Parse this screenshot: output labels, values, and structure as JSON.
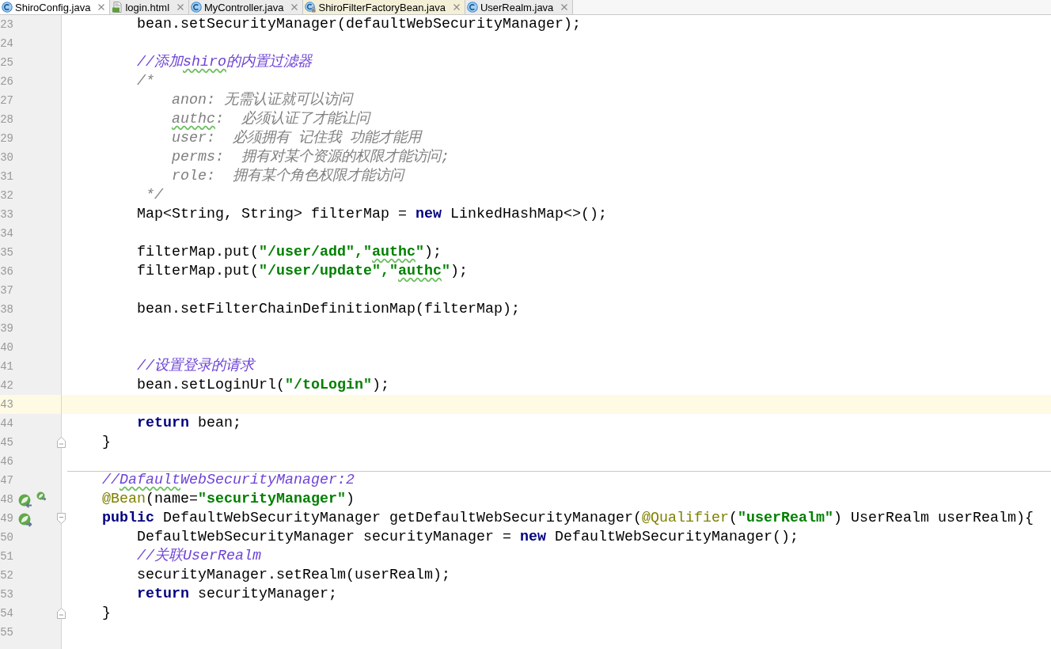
{
  "tabs": [
    {
      "label": "ShiroConfig.java",
      "kind": "class",
      "selected": true,
      "library": false
    },
    {
      "label": "login.html",
      "kind": "html",
      "selected": false,
      "library": false
    },
    {
      "label": "MyController.java",
      "kind": "class",
      "selected": false,
      "library": false
    },
    {
      "label": "ShiroFilterFactoryBean.java",
      "kind": "class-locked",
      "selected": false,
      "library": true
    },
    {
      "label": "UserRealm.java",
      "kind": "class",
      "selected": false,
      "library": false
    }
  ],
  "editor": {
    "lines": [
      {
        "number": "23",
        "segments": [
          {
            "text": "        bean.setSecurityManager(defaultWebSecurityManager);",
            "kind": "plain"
          }
        ]
      },
      {
        "number": "24"
      },
      {
        "number": "25",
        "segments": [
          {
            "text": "        //添加",
            "kind": "line_comment"
          },
          {
            "text": "shiro",
            "kind": "line_comment",
            "typo": true
          },
          {
            "text": "的内置过滤器",
            "kind": "line_comment"
          }
        ]
      },
      {
        "number": "26",
        "segments": [
          {
            "text": "        /*",
            "kind": "block_comment"
          }
        ]
      },
      {
        "number": "27",
        "segments": [
          {
            "text": "            anon: 无需认证就可以访问",
            "kind": "block_comment"
          }
        ]
      },
      {
        "number": "28",
        "segments": [
          {
            "text": "            authc",
            "kind": "block_comment",
            "typo": true
          },
          {
            "text": ":  必须认证了才能让问",
            "kind": "block_comment"
          }
        ]
      },
      {
        "number": "29",
        "segments": [
          {
            "text": "            user:  必须拥有 记住我 功能才能用",
            "kind": "block_comment"
          }
        ]
      },
      {
        "number": "30",
        "segments": [
          {
            "text": "            perms:  拥有对某个资源的权限才能访问;",
            "kind": "block_comment"
          }
        ]
      },
      {
        "number": "31",
        "segments": [
          {
            "text": "            role:  拥有某个角色权限才能访问",
            "kind": "block_comment"
          }
        ]
      },
      {
        "number": "32",
        "segments": [
          {
            "text": "         */",
            "kind": "block_comment"
          }
        ]
      },
      {
        "number": "33",
        "segments": [
          {
            "text": "        Map<String, String> filterMap = ",
            "kind": "plain"
          },
          {
            "text": "new",
            "kind": "keyword"
          },
          {
            "text": " LinkedHashMap<>();",
            "kind": "plain"
          }
        ]
      },
      {
        "number": "34"
      },
      {
        "number": "35",
        "segments": [
          {
            "text": "        filterMap.put(",
            "kind": "plain"
          },
          {
            "text": "\"/user/add\",\"",
            "kind": "string"
          },
          {
            "text": "authc",
            "kind": "string",
            "typo": true
          },
          {
            "text": "\"",
            "kind": "string"
          },
          {
            "text": ");",
            "kind": "plain"
          }
        ]
      },
      {
        "number": "36",
        "segments": [
          {
            "text": "        filterMap.put(",
            "kind": "plain"
          },
          {
            "text": "\"/user/update\",\"",
            "kind": "string"
          },
          {
            "text": "authc",
            "kind": "string",
            "typo": true
          },
          {
            "text": "\"",
            "kind": "string"
          },
          {
            "text": ");",
            "kind": "plain"
          }
        ]
      },
      {
        "number": "37"
      },
      {
        "number": "38",
        "segments": [
          {
            "text": "        bean.setFilterChainDefinitionMap(filterMap);",
            "kind": "plain"
          }
        ]
      },
      {
        "number": "39"
      },
      {
        "number": "40"
      },
      {
        "number": "41",
        "segments": [
          {
            "text": "        //设置登录的请求",
            "kind": "line_comment"
          }
        ]
      },
      {
        "number": "42",
        "segments": [
          {
            "text": "        bean.setLoginUrl(",
            "kind": "plain"
          },
          {
            "text": "\"/toLogin\"",
            "kind": "string"
          },
          {
            "text": ");",
            "kind": "plain"
          }
        ]
      },
      {
        "number": "43",
        "current": true
      },
      {
        "number": "44",
        "segments": [
          {
            "text": "        return",
            "kind": "keyword"
          },
          {
            "text": " bean;",
            "kind": "plain"
          }
        ]
      },
      {
        "number": "45",
        "fold": {
          "kind": "end"
        },
        "segments": [
          {
            "text": "    }",
            "kind": "plain"
          }
        ]
      },
      {
        "number": "46"
      },
      {
        "number": "47",
        "separator": true,
        "segments": [
          {
            "text": "    //",
            "kind": "line_comment"
          },
          {
            "text": "Dafault",
            "kind": "line_comment",
            "typo": true
          },
          {
            "text": "WebSecurityManager:2",
            "kind": "line_comment"
          }
        ]
      },
      {
        "number": "48",
        "gutter_icons": [
          {
            "kind": "leaf-left"
          },
          {
            "kind": "leaf-small"
          }
        ],
        "segments": [
          {
            "text": "    @Bean",
            "kind": "annotation"
          },
          {
            "text": "(name=",
            "kind": "plain"
          },
          {
            "text": "\"securityManager\"",
            "kind": "string"
          },
          {
            "text": ")",
            "kind": "plain"
          }
        ]
      },
      {
        "number": "49",
        "fold": {
          "kind": "start"
        },
        "gutter_icons": [
          {
            "kind": "leaf-right"
          }
        ],
        "segments": [
          {
            "text": "    public",
            "kind": "keyword"
          },
          {
            "text": " DefaultWebSecurityManager getDefaultWebSecurityManager(",
            "kind": "plain"
          },
          {
            "text": "@Qualifier",
            "kind": "annotation"
          },
          {
            "text": "(",
            "kind": "plain"
          },
          {
            "text": "\"userRealm\"",
            "kind": "string"
          },
          {
            "text": ") UserRealm userRealm){",
            "kind": "plain"
          }
        ]
      },
      {
        "number": "50",
        "segments": [
          {
            "text": "        DefaultWebSecurityManager securityManager = ",
            "kind": "plain"
          },
          {
            "text": "new",
            "kind": "keyword"
          },
          {
            "text": " DefaultWebSecurityManager();",
            "kind": "plain"
          }
        ]
      },
      {
        "number": "51",
        "segments": [
          {
            "text": "        //关联UserRealm",
            "kind": "line_comment"
          }
        ]
      },
      {
        "number": "52",
        "segments": [
          {
            "text": "        securityManager.setRealm(userRealm);",
            "kind": "plain"
          }
        ]
      },
      {
        "number": "53",
        "segments": [
          {
            "text": "        return",
            "kind": "keyword"
          },
          {
            "text": " securityManager;",
            "kind": "plain"
          }
        ]
      },
      {
        "number": "54",
        "fold": {
          "kind": "end"
        },
        "segments": [
          {
            "text": "    }",
            "kind": "plain"
          }
        ]
      },
      {
        "number": "55"
      }
    ]
  }
}
